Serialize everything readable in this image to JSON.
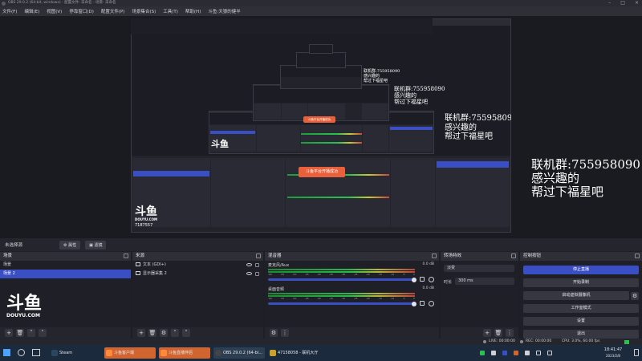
{
  "titlebar": {
    "text": "OBS 29.0.2 (64-bit, windows) - 配置文件: 未命名 - 场景: 未命名"
  },
  "menu": [
    "文件(F)",
    "编辑(E)",
    "视图(V)",
    "停靠窗口(D)",
    "配置文件(P)",
    "场景集合(S)",
    "工具(T)",
    "帮助(H)",
    "斗鱼:天狼的健半"
  ],
  "overlay": {
    "group_line": "联机群:755958090",
    "line2": "感兴趣的",
    "line3": "帮过下福星吧",
    "toast": "斗鱼平台开播成功",
    "logo_main": "斗鱼",
    "logo_sub": "DOUYU.COM",
    "room": "7187557"
  },
  "strip": {
    "label": "未选择源",
    "btn_props": "属性",
    "btn_filters": "滤镜"
  },
  "scenes": {
    "title": "场景",
    "items": [
      "场景",
      "场景 2"
    ],
    "selected": 1
  },
  "sources": {
    "title": "来源",
    "items": [
      {
        "name": "文本 (GDI+)"
      },
      {
        "name": "显示器采集 2"
      }
    ]
  },
  "mixer": {
    "title": "混音器",
    "channels": [
      {
        "name": "麦克风/Aux",
        "db": "0.0 dB"
      },
      {
        "name": "桌面音频",
        "db": "0.0 dB"
      }
    ],
    "ticks": [
      "-60",
      "-55",
      "-50",
      "-45",
      "-40",
      "-35",
      "-30",
      "-25",
      "-20",
      "-15",
      "-10",
      "-5",
      "0"
    ]
  },
  "transitions": {
    "title": "转场特效",
    "type": "淡变",
    "duration_label": "时长",
    "duration": "300 ms"
  },
  "controls": {
    "title": "控制按钮",
    "buttons": [
      "停止直播",
      "开始录制",
      "启动虚拟摄像机",
      "工作室模式",
      "设置",
      "退出"
    ]
  },
  "status": {
    "live": "LIVE: 00:00:00",
    "rec": "REC: 00:00:00",
    "cpu": "CPU: 3.0%, 60.00 fps"
  },
  "taskbar": {
    "items": [
      "Steam",
      "斗鱼客户端",
      "斗鱼直播伴侣",
      "OBS 29.0.2 (64-bi...",
      "47158058 - 联机大厅"
    ],
    "time": "18:41:47",
    "date": "2023/2/8"
  },
  "colors": {
    "accent": "#3b4fc4",
    "toast": "#e9603a",
    "panel": "#25262d"
  }
}
